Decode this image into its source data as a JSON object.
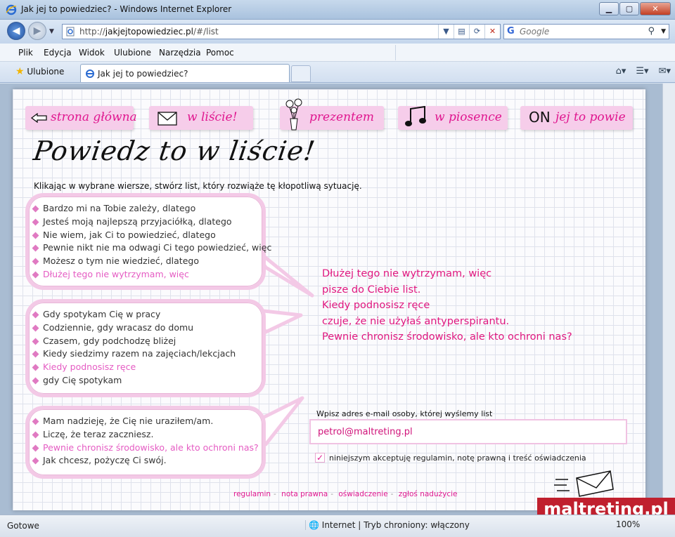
{
  "window": {
    "title": "Jak jej to powiedziec? - Windows Internet Explorer",
    "min": "▁",
    "max": "▢",
    "close": "✕"
  },
  "address": {
    "url_prefix": "http://",
    "url_host": "jakjejtopowiedziec.pl",
    "url_path": "/#/list"
  },
  "search": {
    "engine": "G",
    "placeholder": "Google"
  },
  "menu": [
    "Plik",
    "Edycja",
    "Widok",
    "Ulubione",
    "Narzędzia",
    "Pomoc"
  ],
  "favorites_label": "Ulubione",
  "tab_label": "Jak jej to powiedziec?",
  "site_nav": {
    "home": "strona główna",
    "letter": "w liście!",
    "gift": "prezentem",
    "song": "w piosence",
    "on_prefix": "ON",
    "on": "jej to powie"
  },
  "heading": "Powiedz to w liście!",
  "subtitle": "Klikając w wybrane wiersze, stwórz list, który rozwiąże tę kłopotliwą sytuację.",
  "groups": [
    {
      "items": [
        {
          "text": "Bardzo mi na Tobie zależy, dlatego",
          "selected": false
        },
        {
          "text": "Jesteś moją najlepszą przyjaciółką, dlatego",
          "selected": false
        },
        {
          "text": "Nie wiem, jak Ci to powiedzieć, dlatego",
          "selected": false
        },
        {
          "text": "Pewnie nikt nie ma odwagi Ci tego powiedzieć, więc",
          "selected": false
        },
        {
          "text": "Możesz o tym nie wiedzieć, dlatego",
          "selected": false
        },
        {
          "text": "Dłużej tego nie wytrzymam, więc",
          "selected": true
        }
      ]
    },
    {
      "items": [
        {
          "text": "Gdy spotykam Cię w pracy",
          "selected": false
        },
        {
          "text": "Codziennie, gdy wracasz do domu",
          "selected": false
        },
        {
          "text": "Czasem, gdy podchodzę bliżej",
          "selected": false
        },
        {
          "text": "Kiedy siedzimy razem na zajęciach/lekcjach",
          "selected": false
        },
        {
          "text": "Kiedy podnosisz ręce",
          "selected": true
        },
        {
          "text": "gdy Cię spotykam",
          "selected": false
        }
      ]
    },
    {
      "items": [
        {
          "text": "Mam nadzieję, że Cię nie uraziłem/am.",
          "selected": false
        },
        {
          "text": "Liczę, że teraz zaczniesz.",
          "selected": false
        },
        {
          "text": "Pewnie chronisz środowisko, ale kto ochroni nas?",
          "selected": true
        },
        {
          "text": "Jak chcesz, pożyczę Ci swój.",
          "selected": false
        }
      ]
    }
  ],
  "letter_lines": [
    "Dłużej tego nie wytrzymam, więc",
    "pisze do Ciebie list.",
    "Kiedy podnosisz ręce",
    "czuje, że nie użyłaś antyperspirantu.",
    "Pewnie chronisz środowisko, ale kto ochroni nas?"
  ],
  "email": {
    "label": "Wpisz adres e-mail osoby, której wyślemy list",
    "value": "petrol@maltreting.pl"
  },
  "agree": {
    "checked": true,
    "mark": "✓",
    "label": "niniejszym akceptuję regulamin, notę prawną i treść oświadczenia"
  },
  "footer_links": [
    "regulamin",
    "nota prawna",
    "oświadczenie",
    "zgłoś nadużycie"
  ],
  "watermark": "maltreting.pl",
  "status": {
    "text": "Gotowe",
    "zone": "Internet | Tryb chroniony: włączony",
    "zoom": "100%"
  },
  "colors": {
    "accent": "#e0178f",
    "bubble_border": "#f3c9e6",
    "nav_bg": "#f6cdea"
  }
}
